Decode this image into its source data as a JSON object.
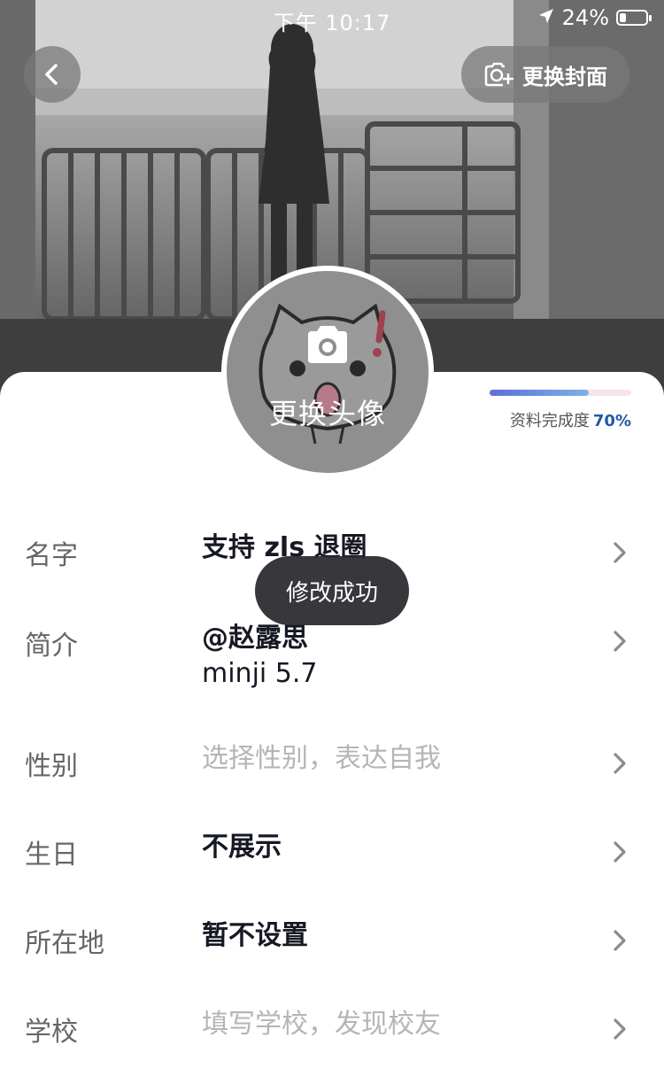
{
  "status_bar": {
    "time": "下午 10:17",
    "battery": "24%",
    "battery_level": 0.24,
    "icons": [
      "location-arrow-icon",
      "battery-icon"
    ]
  },
  "header": {
    "back_icon": "chevron-left-icon",
    "change_cover_label": "更换封面",
    "change_cover_icon": "camera-plus-icon"
  },
  "avatar": {
    "label": "更换头像",
    "camera_icon": "camera-icon"
  },
  "completion": {
    "label": "资料完成度",
    "percent_text": "70%",
    "fraction": 0.7,
    "colors": {
      "fill_start": "#5b6fd8",
      "fill_end": "#7fb0e8",
      "track": "#f7e3ea"
    }
  },
  "rows": [
    {
      "label": "名字",
      "value": "支持 zls 退圈",
      "placeholder": false
    },
    {
      "label": "简介",
      "value_line1": "@赵露思",
      "value_line2": "minji  5.7",
      "placeholder": false
    },
    {
      "label": "性别",
      "value": "选择性别，表达自我",
      "placeholder": true
    },
    {
      "label": "生日",
      "value": "不展示",
      "placeholder": false
    },
    {
      "label": "所在地",
      "value": "暂不设置",
      "placeholder": false
    },
    {
      "label": "学校",
      "value": "填写学校，发现校友",
      "placeholder": true
    }
  ],
  "toast": {
    "message": "修改成功"
  }
}
